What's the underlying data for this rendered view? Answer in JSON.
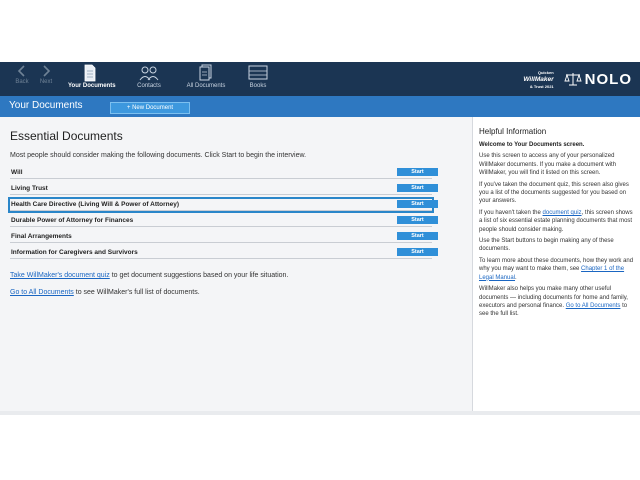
{
  "toolbar": {
    "back": "Back",
    "next": "Next",
    "your_documents": "Your Documents",
    "contacts": "Contacts",
    "all_documents": "All Documents",
    "books": "Books"
  },
  "brand": {
    "product_top": "Quicken",
    "product": "WillMaker",
    "product_sub": "& Trust 2021",
    "company": "NOLO"
  },
  "titlebar": {
    "title": "Your Documents",
    "new_document": "+ New Document"
  },
  "main": {
    "heading": "Essential Documents",
    "intro": "Most people should consider making the following documents. Click Start to begin the interview.",
    "start_label": "Start",
    "documents": [
      {
        "name": "Will"
      },
      {
        "name": "Living Trust"
      },
      {
        "name": "Health Care Directive (Living Will & Power of Attorney)"
      },
      {
        "name": "Durable Power of Attorney for Finances"
      },
      {
        "name": "Final Arrangements"
      },
      {
        "name": "Information for Caregivers and Survivors"
      }
    ],
    "quiz_link": "Take WillMaker's document quiz",
    "quiz_rest": " to get document suggestions based on your life situation.",
    "all_link": "Go to All Documents",
    "all_rest": " to see WillMaker's full list of documents."
  },
  "help": {
    "title": "Helpful Information",
    "welcome": "Welcome to Your Documents screen.",
    "p1": "Use this screen to access any of your personalized WillMaker documents. If you make a document with WillMaker, you will find it listed on this screen.",
    "p2": "If you've taken the document quiz, this screen also gives you a list of the documents suggested for you based on your answers.",
    "p3_a": "If you haven't taken the ",
    "p3_link": "document quiz",
    "p3_b": ", this screen shows a list of six essential estate planning documents that most people should consider making.",
    "p4": "Use the Start buttons to begin making any of these documents.",
    "p5_a": "To learn more about these documents, how they work and why you may want to make them, see ",
    "p5_link": "Chapter 1 of the Legal Manual",
    "p5_b": ".",
    "p6_a": "WillMaker also helps you make many other useful documents — including documents for home and family, executors and personal finance. ",
    "p6_link": "Go to All Documents",
    "p6_b": " to see the full list."
  },
  "colors": {
    "toolbar_bg": "#1b3553",
    "titlebar_bg": "#2e78c1",
    "start_button": "#2f8fd8",
    "highlight_outline": "#2a86c9",
    "link": "#1a66c2"
  },
  "icons": [
    "back-arrow-icon",
    "next-arrow-icon",
    "document-icon",
    "contacts-icon",
    "all-documents-icon",
    "books-icon",
    "nolo-scales-icon"
  ]
}
